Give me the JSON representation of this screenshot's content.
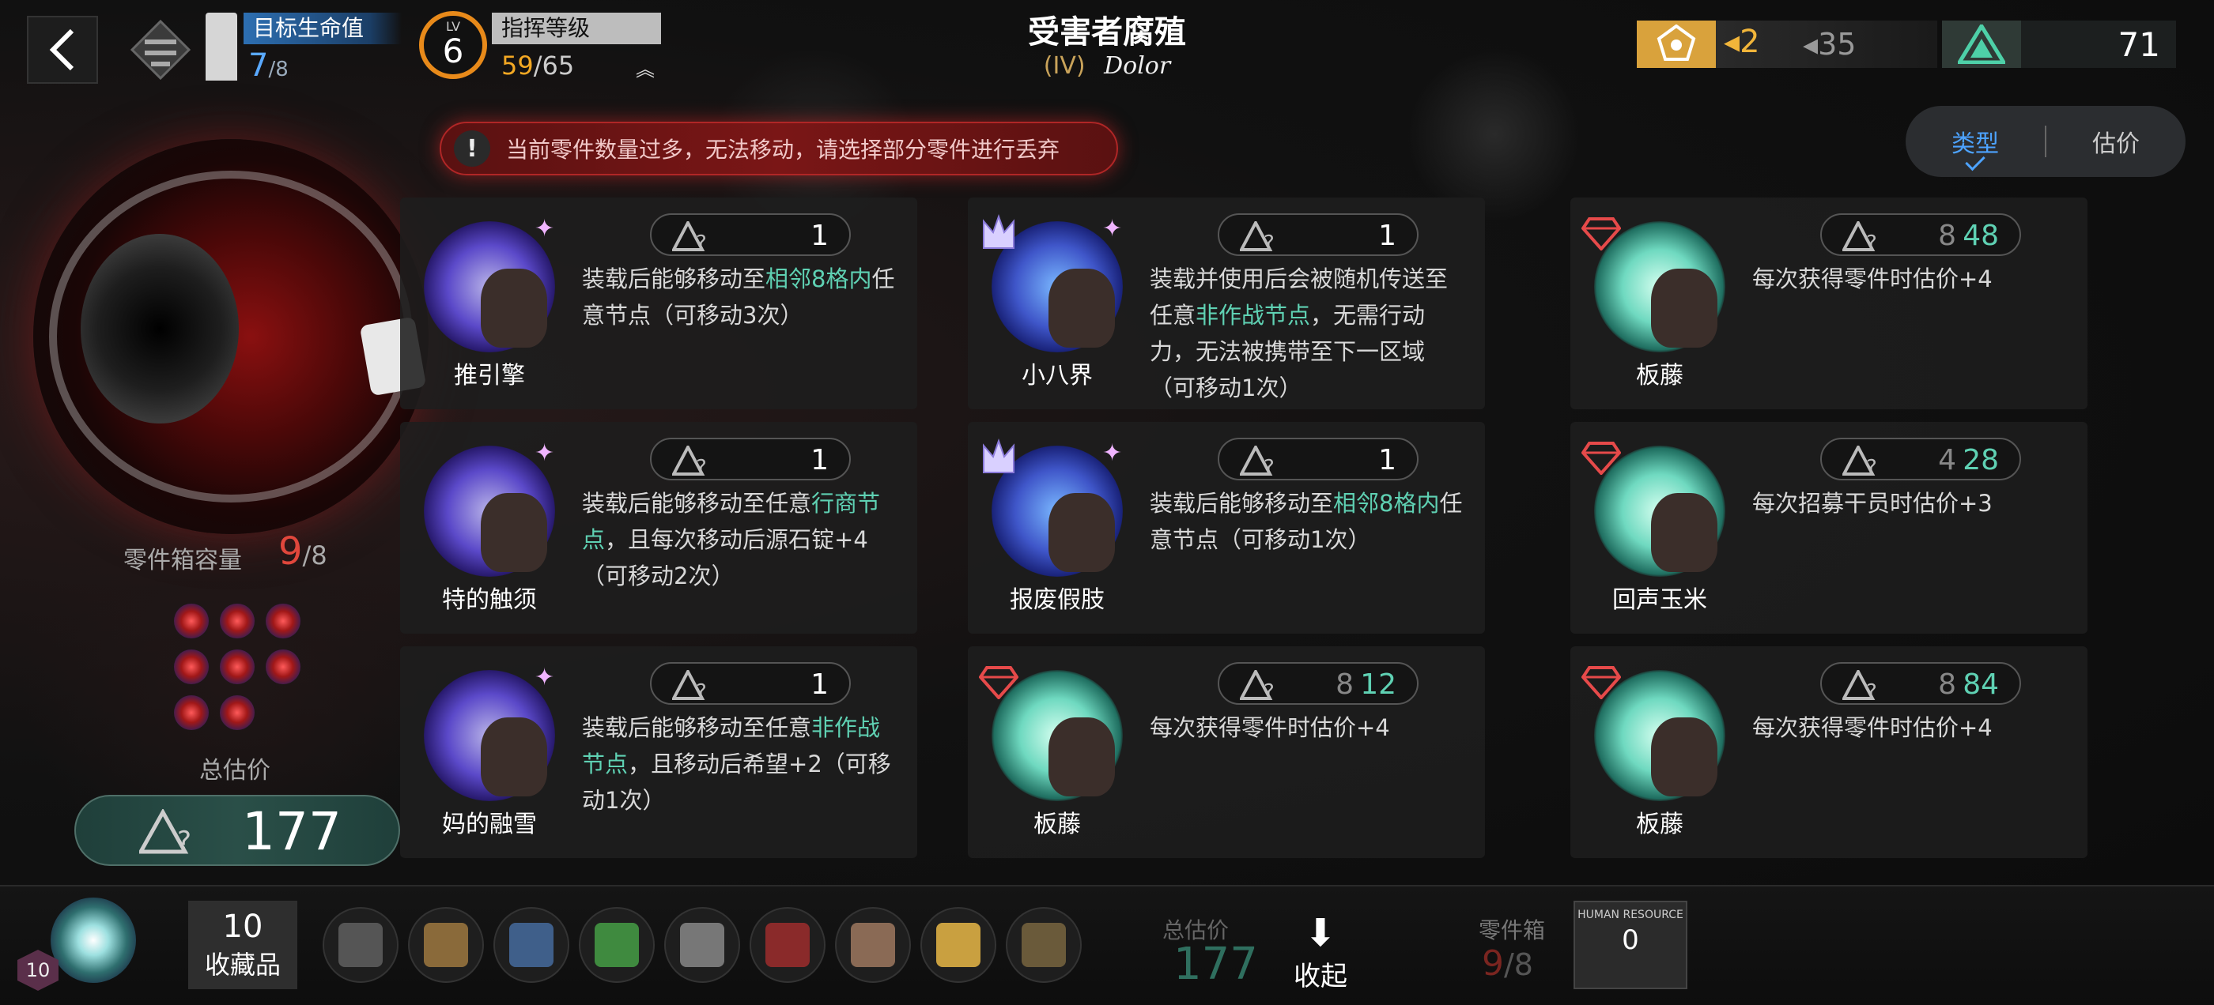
{
  "header": {
    "hp_label": "目标生命值",
    "hp_value": "7",
    "hp_max": "/8",
    "level_label": "LV",
    "level_value": "6",
    "command_label": "指挥等级",
    "command_value": "59",
    "command_max": "/65",
    "title": "受害者腐殖",
    "subtitle_roman": "(IV)",
    "subtitle_text": "Dolor",
    "gold_value": "2",
    "gold_max": "35",
    "teal_value": "71"
  },
  "warning": {
    "text": "当前零件数量过多，无法移动，请选择部分零件进行丢弃"
  },
  "sort": {
    "options": [
      "类型",
      "估价"
    ],
    "active": "类型"
  },
  "left_panel": {
    "capacity_label": "零件箱容量",
    "capacity_value": "9",
    "capacity_max": "/8",
    "total_label": "总估价",
    "total_value": "177"
  },
  "cards": [
    {
      "name": "推引擎",
      "value": "1",
      "desc_parts": [
        "装载后能够移动至",
        "相邻8格内",
        "任意节点（可移动3次）"
      ],
      "icon": "engine-icon",
      "tier": "none"
    },
    {
      "name": "小八界",
      "value": "1",
      "desc_parts": [
        "装载并使用后会被随机传送至任意",
        "非作战节点",
        "，无需行动力，无法被携带至下一区域（可移动1次）"
      ],
      "icon": "creature-icon",
      "tier": "crown"
    },
    {
      "name": "板藤",
      "value_old": "8",
      "value_new": "48",
      "desc_parts": [
        "每次获得零件时估价+4",
        "",
        ""
      ],
      "icon": "vine-icon",
      "tier": "diamond"
    },
    {
      "name": "特的触须",
      "value": "1",
      "desc_parts": [
        "装载后能够移动至任意",
        "行商节点",
        "，且每次移动后源石锭+4（可移动2次）"
      ],
      "icon": "tentacle-icon",
      "tier": "none"
    },
    {
      "name": "报废假肢",
      "value": "1",
      "desc_parts": [
        "装载后能够移动至",
        "相邻8格内",
        "任意节点（可移动1次）"
      ],
      "icon": "prosthetic-icon",
      "tier": "crown"
    },
    {
      "name": "回声玉米",
      "value_old": "4",
      "value_new": "28",
      "desc_parts": [
        "每次招募干员时估价+3",
        "",
        ""
      ],
      "icon": "corn-icon",
      "tier": "diamond"
    },
    {
      "name": "妈的融雪",
      "value": "1",
      "desc_parts": [
        "装载后能够移动至任意",
        "非作战节点",
        "，且移动后希望+2（可移动1次）"
      ],
      "icon": "snow-icon",
      "tier": "none"
    },
    {
      "name": "板藤",
      "value_old": "8",
      "value_new": "12",
      "desc_parts": [
        "每次获得零件时估价+4",
        "",
        ""
      ],
      "icon": "vine-icon",
      "tier": "diamond"
    },
    {
      "name": "板藤",
      "value_old": "8",
      "value_new": "84",
      "desc_parts": [
        "每次获得零件时估价+4",
        "",
        ""
      ],
      "icon": "vine-icon",
      "tier": "diamond"
    }
  ],
  "bottom_bar": {
    "level_badge": "10",
    "collection_count": "10",
    "collection_label": "收藏品",
    "inventory_icons": [
      "dagger-icon",
      "bow-icon",
      "book-icon",
      "leaf-icon",
      "scroll-icon",
      "drum-icon",
      "map-icon",
      "jar-icon",
      "acorn-icon"
    ],
    "total_label": "总估价",
    "total_value": "177",
    "collapse_label": "收起",
    "box_label": "零件箱",
    "box_value": "9",
    "box_max": "/8",
    "hr_label": "HUMAN RESOURCE",
    "hr_value": "0"
  },
  "colors": {
    "highlight": "#5fd1b3",
    "warning_red": "#b02626",
    "accent_blue": "#4da3ff",
    "gold": "#f1b53a"
  }
}
